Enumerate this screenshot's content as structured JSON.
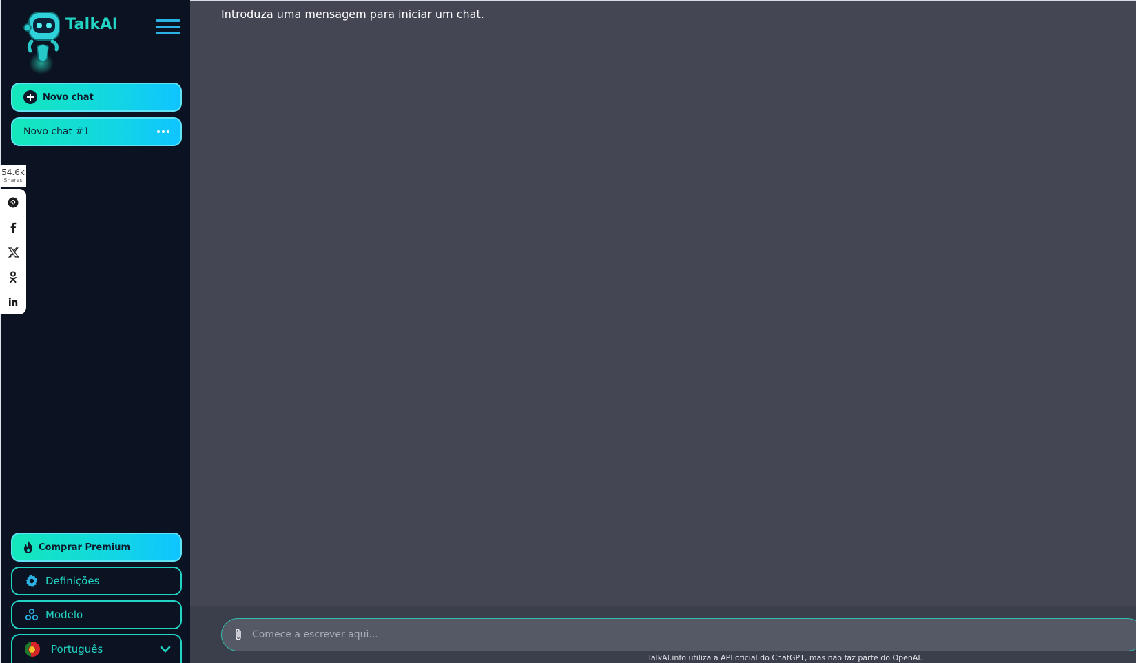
{
  "sidebar": {
    "brand": "TalkAI",
    "new_chat_label": "Novo chat",
    "chats": [
      {
        "label": "Novo chat #1"
      }
    ],
    "premium_label": "Comprar Premium",
    "settings_label": "Definições",
    "model_label": "Modelo",
    "language_label": "Português"
  },
  "social": {
    "share_count": "54.6k",
    "shares_label": "Shares",
    "networks": [
      "pinterest-icon",
      "facebook-icon",
      "x-icon",
      "odnoklassniki-icon",
      "linkedin-icon"
    ]
  },
  "main": {
    "intro_text": "Introduza uma mensagem para iniciar um chat.",
    "input_placeholder": "Comece a escrever aqui...",
    "disclaimer": "TalkAI.info utiliza a API oficial do ChatGPT, mas não faz parte do OpenAI."
  },
  "colors": {
    "accent": "#22d4c4",
    "sidebar_bg": "#0b1221",
    "main_bg": "#444654"
  }
}
